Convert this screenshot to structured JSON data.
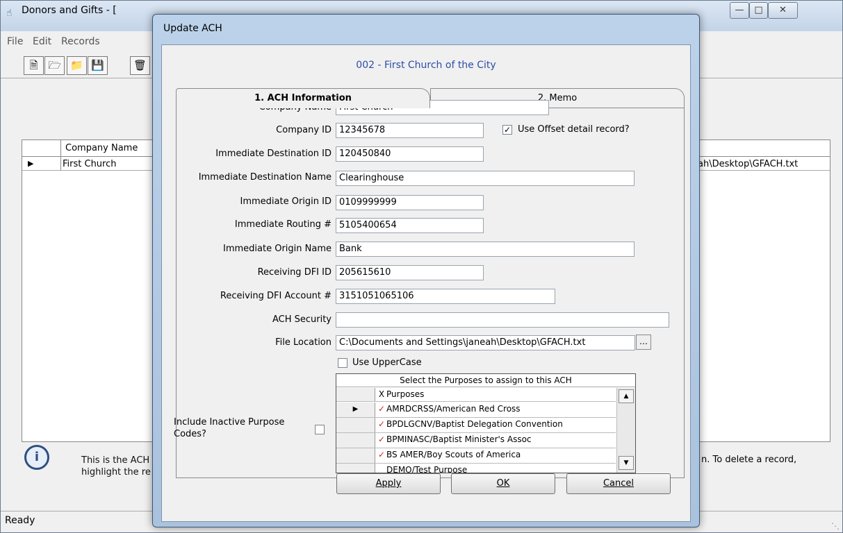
{
  "background_window": {
    "title": "Donors and Gifts - [",
    "menu": [
      "File",
      "Edit",
      "Records"
    ],
    "grid": {
      "column": "Company Name",
      "row": {
        "company": "First Church",
        "file": "eah\\Desktop\\GFACH.txt"
      }
    },
    "info_left": "This is the ACH highlight the re",
    "info_right": "n.  To delete a record,",
    "status": "Ready"
  },
  "dialog": {
    "title": "Update ACH",
    "heading": "002 - First Church of the City",
    "tabs": [
      "1. ACH Information",
      "2. Memo"
    ],
    "fields": {
      "company_name": {
        "label": "Company Name",
        "value": "First Church"
      },
      "company_id": {
        "label": "Company ID",
        "value": "12345678"
      },
      "immediate_destination_id": {
        "label": "Immediate Destination ID",
        "value": "120450840"
      },
      "immediate_destination_name": {
        "label": "Immediate Destination Name",
        "value": "Clearinghouse"
      },
      "immediate_origin_id": {
        "label": "Immediate Origin ID",
        "value": "0109999999"
      },
      "immediate_routing": {
        "label": "Immediate Routing #",
        "value": "5105400654"
      },
      "immediate_origin_name": {
        "label": "Immediate Origin Name",
        "value": "Bank"
      },
      "receiving_dfi_id": {
        "label": "Receiving DFI ID",
        "value": "205615610"
      },
      "receiving_dfi_account": {
        "label": "Receiving DFI Account #",
        "value": "3151051065106"
      },
      "ach_security": {
        "label": "ACH Security",
        "value": ""
      },
      "file_location": {
        "label": "File Location",
        "value": "C:\\Documents and Settings\\janeah\\Desktop\\GFACH.txt"
      }
    },
    "use_offset": {
      "label": "Use Offset detail record?",
      "checked": true
    },
    "use_uppercase": {
      "label": "Use UpperCase",
      "checked": false
    },
    "include_inactive": {
      "label": "Include Inactive Purpose Codes?",
      "checked": false
    },
    "purposes": {
      "title": "Select the Purposes to assign to this ACH",
      "col_x": "X",
      "col_name": "Purposes",
      "rows": [
        {
          "name": "AMRDCRSS/American Red Cross",
          "checked": true,
          "current": true
        },
        {
          "name": "BPDLGCNV/Baptist Delegation Convention",
          "checked": true,
          "current": false
        },
        {
          "name": "BPMINASC/Baptist Minister's Assoc",
          "checked": true,
          "current": false
        },
        {
          "name": "BS AMER/Boy Scouts of America",
          "checked": true,
          "current": false
        },
        {
          "name": "DEMO/Test Purpose",
          "checked": false,
          "current": false
        }
      ]
    },
    "buttons": {
      "apply": "Apply",
      "ok": "OK",
      "cancel": "Cancel"
    }
  }
}
